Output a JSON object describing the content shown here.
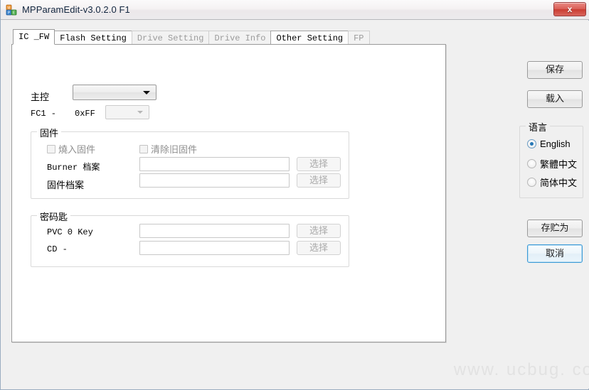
{
  "window": {
    "title": "MPParamEdit-v3.0.2.0 F1",
    "icon": "blocks-icon",
    "close_label": "x",
    "accent": "#2577b5",
    "close_color": "#c93c32"
  },
  "tabs": [
    {
      "label": "IC _FW",
      "state": "active"
    },
    {
      "label": "Flash Setting",
      "state": "enabled"
    },
    {
      "label": "Drive Setting",
      "state": "disabled"
    },
    {
      "label": "Drive Info",
      "state": "disabled"
    },
    {
      "label": "Other Setting",
      "state": "enabled"
    },
    {
      "label": "FP",
      "state": "disabled"
    }
  ],
  "main": {
    "controller": {
      "label": "主控",
      "combo_value": "",
      "sub_label": "FC1 -",
      "sub_value": "0xFF",
      "sub_combo_value": ""
    },
    "firmware_group": {
      "title": "固件",
      "burn_checkbox": {
        "label": "燒入固件",
        "checked": false
      },
      "clear_checkbox": {
        "label": "清除旧固件",
        "checked": false
      },
      "rows": [
        {
          "label": "Burner 档案",
          "value": "",
          "button": "选择"
        },
        {
          "label": "固件档案",
          "value": "",
          "button": "选择"
        }
      ]
    },
    "key_group": {
      "title": "密码匙",
      "rows": [
        {
          "label": "PVC 0 Key",
          "value": "",
          "button": "选择"
        },
        {
          "label": "CD -",
          "value": "",
          "button": "选择"
        }
      ]
    }
  },
  "side": {
    "save_button": "保存",
    "load_button": "载入",
    "language_group": {
      "title": "语言",
      "options": [
        {
          "label": "English",
          "checked": true
        },
        {
          "label": "繁體中文",
          "checked": false
        },
        {
          "label": "简体中文",
          "checked": false
        }
      ]
    },
    "save_as_button": "存贮为",
    "cancel_button": "取消"
  },
  "watermark": "www. ucbug. co"
}
